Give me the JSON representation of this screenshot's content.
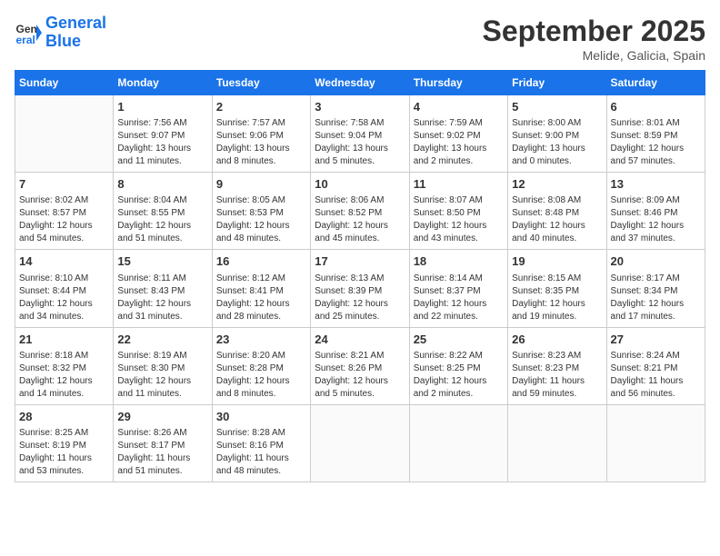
{
  "header": {
    "logo_line1": "General",
    "logo_line2": "Blue",
    "month": "September 2025",
    "location": "Melide, Galicia, Spain"
  },
  "weekdays": [
    "Sunday",
    "Monday",
    "Tuesday",
    "Wednesday",
    "Thursday",
    "Friday",
    "Saturday"
  ],
  "weeks": [
    [
      {
        "day": "",
        "info": ""
      },
      {
        "day": "1",
        "info": "Sunrise: 7:56 AM\nSunset: 9:07 PM\nDaylight: 13 hours\nand 11 minutes."
      },
      {
        "day": "2",
        "info": "Sunrise: 7:57 AM\nSunset: 9:06 PM\nDaylight: 13 hours\nand 8 minutes."
      },
      {
        "day": "3",
        "info": "Sunrise: 7:58 AM\nSunset: 9:04 PM\nDaylight: 13 hours\nand 5 minutes."
      },
      {
        "day": "4",
        "info": "Sunrise: 7:59 AM\nSunset: 9:02 PM\nDaylight: 13 hours\nand 2 minutes."
      },
      {
        "day": "5",
        "info": "Sunrise: 8:00 AM\nSunset: 9:00 PM\nDaylight: 13 hours\nand 0 minutes."
      },
      {
        "day": "6",
        "info": "Sunrise: 8:01 AM\nSunset: 8:59 PM\nDaylight: 12 hours\nand 57 minutes."
      }
    ],
    [
      {
        "day": "7",
        "info": "Sunrise: 8:02 AM\nSunset: 8:57 PM\nDaylight: 12 hours\nand 54 minutes."
      },
      {
        "day": "8",
        "info": "Sunrise: 8:04 AM\nSunset: 8:55 PM\nDaylight: 12 hours\nand 51 minutes."
      },
      {
        "day": "9",
        "info": "Sunrise: 8:05 AM\nSunset: 8:53 PM\nDaylight: 12 hours\nand 48 minutes."
      },
      {
        "day": "10",
        "info": "Sunrise: 8:06 AM\nSunset: 8:52 PM\nDaylight: 12 hours\nand 45 minutes."
      },
      {
        "day": "11",
        "info": "Sunrise: 8:07 AM\nSunset: 8:50 PM\nDaylight: 12 hours\nand 43 minutes."
      },
      {
        "day": "12",
        "info": "Sunrise: 8:08 AM\nSunset: 8:48 PM\nDaylight: 12 hours\nand 40 minutes."
      },
      {
        "day": "13",
        "info": "Sunrise: 8:09 AM\nSunset: 8:46 PM\nDaylight: 12 hours\nand 37 minutes."
      }
    ],
    [
      {
        "day": "14",
        "info": "Sunrise: 8:10 AM\nSunset: 8:44 PM\nDaylight: 12 hours\nand 34 minutes."
      },
      {
        "day": "15",
        "info": "Sunrise: 8:11 AM\nSunset: 8:43 PM\nDaylight: 12 hours\nand 31 minutes."
      },
      {
        "day": "16",
        "info": "Sunrise: 8:12 AM\nSunset: 8:41 PM\nDaylight: 12 hours\nand 28 minutes."
      },
      {
        "day": "17",
        "info": "Sunrise: 8:13 AM\nSunset: 8:39 PM\nDaylight: 12 hours\nand 25 minutes."
      },
      {
        "day": "18",
        "info": "Sunrise: 8:14 AM\nSunset: 8:37 PM\nDaylight: 12 hours\nand 22 minutes."
      },
      {
        "day": "19",
        "info": "Sunrise: 8:15 AM\nSunset: 8:35 PM\nDaylight: 12 hours\nand 19 minutes."
      },
      {
        "day": "20",
        "info": "Sunrise: 8:17 AM\nSunset: 8:34 PM\nDaylight: 12 hours\nand 17 minutes."
      }
    ],
    [
      {
        "day": "21",
        "info": "Sunrise: 8:18 AM\nSunset: 8:32 PM\nDaylight: 12 hours\nand 14 minutes."
      },
      {
        "day": "22",
        "info": "Sunrise: 8:19 AM\nSunset: 8:30 PM\nDaylight: 12 hours\nand 11 minutes."
      },
      {
        "day": "23",
        "info": "Sunrise: 8:20 AM\nSunset: 8:28 PM\nDaylight: 12 hours\nand 8 minutes."
      },
      {
        "day": "24",
        "info": "Sunrise: 8:21 AM\nSunset: 8:26 PM\nDaylight: 12 hours\nand 5 minutes."
      },
      {
        "day": "25",
        "info": "Sunrise: 8:22 AM\nSunset: 8:25 PM\nDaylight: 12 hours\nand 2 minutes."
      },
      {
        "day": "26",
        "info": "Sunrise: 8:23 AM\nSunset: 8:23 PM\nDaylight: 11 hours\nand 59 minutes."
      },
      {
        "day": "27",
        "info": "Sunrise: 8:24 AM\nSunset: 8:21 PM\nDaylight: 11 hours\nand 56 minutes."
      }
    ],
    [
      {
        "day": "28",
        "info": "Sunrise: 8:25 AM\nSunset: 8:19 PM\nDaylight: 11 hours\nand 53 minutes."
      },
      {
        "day": "29",
        "info": "Sunrise: 8:26 AM\nSunset: 8:17 PM\nDaylight: 11 hours\nand 51 minutes."
      },
      {
        "day": "30",
        "info": "Sunrise: 8:28 AM\nSunset: 8:16 PM\nDaylight: 11 hours\nand 48 minutes."
      },
      {
        "day": "",
        "info": ""
      },
      {
        "day": "",
        "info": ""
      },
      {
        "day": "",
        "info": ""
      },
      {
        "day": "",
        "info": ""
      }
    ]
  ]
}
